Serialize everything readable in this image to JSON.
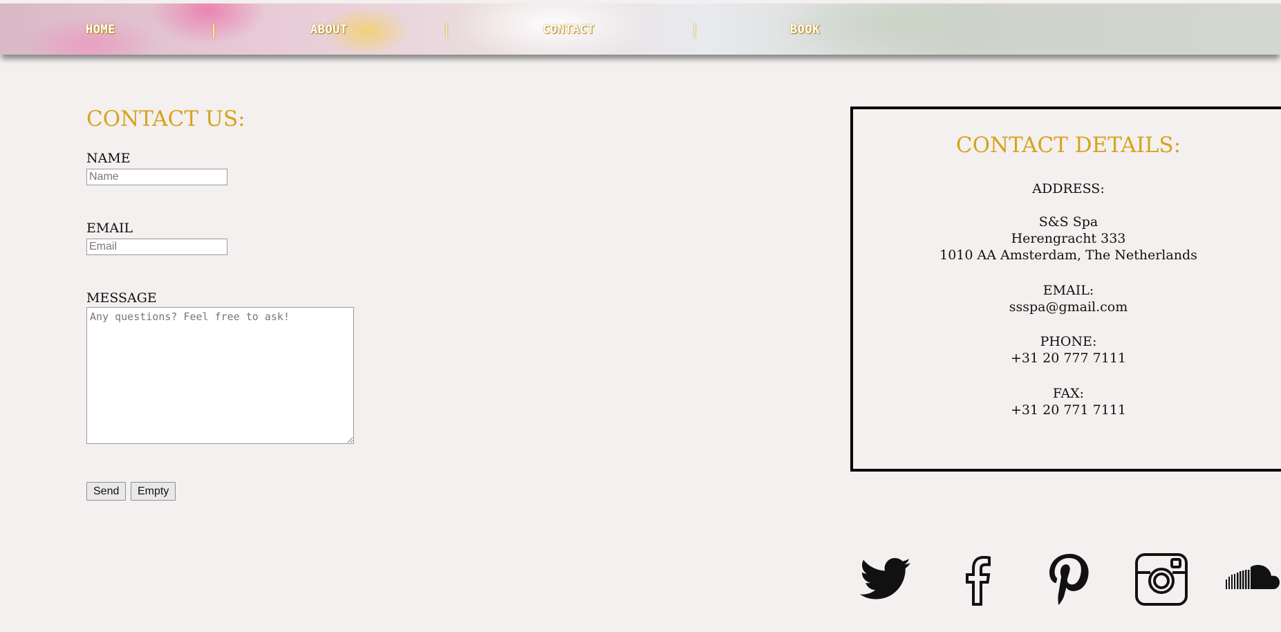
{
  "nav": {
    "items": [
      "HOME",
      "ABOUT",
      "CONTACT",
      "BOOK"
    ],
    "separator": "|"
  },
  "contact_form": {
    "heading": "CONTACT US:",
    "name_label": "NAME",
    "name_placeholder": "Name",
    "name_value": "",
    "email_label": "EMAIL",
    "email_placeholder": "Email",
    "email_value": "",
    "message_label": "MESSAGE",
    "message_placeholder": "Any questions? Feel free to ask!",
    "message_value": "",
    "send_label": "Send",
    "empty_label": "Empty"
  },
  "contact_details": {
    "heading": "CONTACT DETAILS:",
    "address_label": "ADDRESS:",
    "address_lines": [
      "S&S Spa",
      "Herengracht 333",
      "1010 AA Amsterdam, The Netherlands"
    ],
    "email_label": "EMAIL:",
    "email": "ssspa@gmail.com",
    "phone_label": "PHONE:",
    "phone": "+31 20 777 7111",
    "fax_label": "FAX:",
    "fax": "+31 20 771 7111"
  },
  "social": [
    "twitter-icon",
    "facebook-icon",
    "pinterest-icon",
    "instagram-icon",
    "soundcloud-icon"
  ],
  "colors": {
    "accent": "#d8a31c",
    "background": "#f3f0ef",
    "text": "#111111"
  }
}
